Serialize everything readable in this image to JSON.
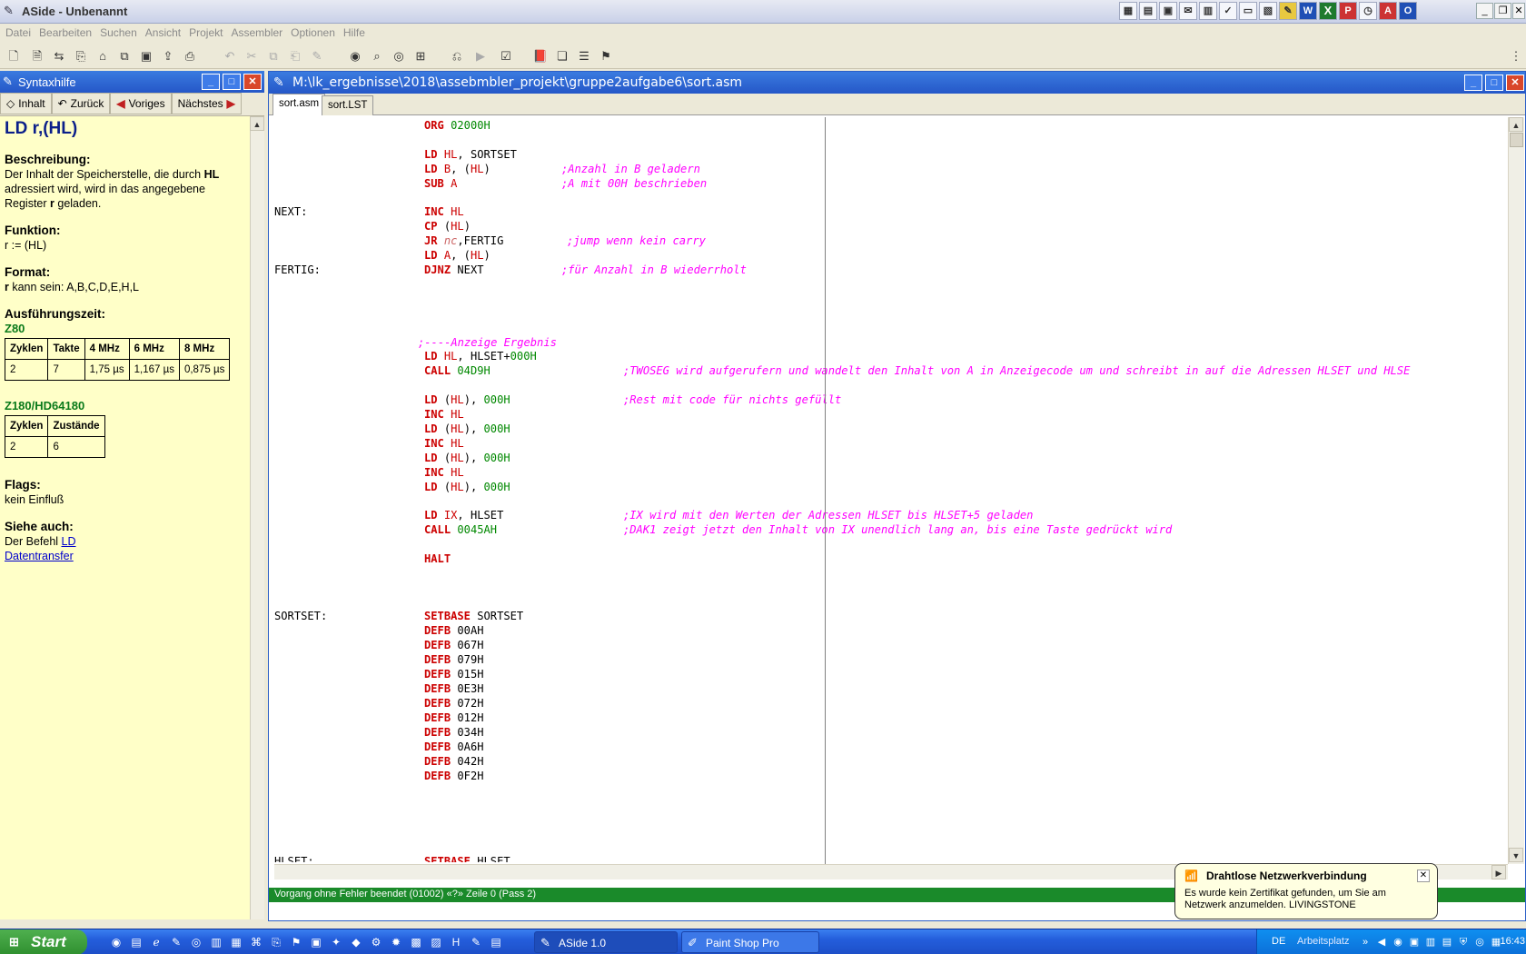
{
  "app": {
    "title": "ASide - Unbenannt"
  },
  "menubar": [
    "Datei",
    "Bearbeiten",
    "Suchen",
    "Ansicht",
    "Projekt",
    "Assembler",
    "Optionen",
    "Hilfe"
  ],
  "help": {
    "title": "Syntaxhilfe",
    "nav": {
      "inhalt": "Inhalt",
      "zurueck": "Zurück",
      "voriges": "Voriges",
      "naechstes": "Nächstes"
    },
    "heading": "LD r,(HL)",
    "beschreibung_title": "Beschreibung",
    "beschreibung_pre": "Der Inhalt der Speicherstelle, die durch ",
    "beschreibung_hl": "HL",
    "beschreibung_mid": " adressiert wird, wird in das angegebene Register ",
    "beschreibung_r": "r",
    "beschreibung_post": " geladen.",
    "funktion_title": "Funktion",
    "funktion": "r := (HL)",
    "format_title": "Format",
    "format_r": "r",
    "format": " kann sein: A,B,C,D,E,H,L",
    "zeit_title": "Ausführungszeit",
    "z80_label": "Z80",
    "z80_table": {
      "headers": [
        "Zyklen",
        "Takte",
        "4 MHz",
        "6 MHz",
        "8 MHz"
      ],
      "row": [
        "2",
        "7",
        "1,75 µs",
        "1,167 µs",
        "0,875 µs"
      ]
    },
    "z180_label": "Z180/HD64180",
    "z180_table": {
      "headers": [
        "Zyklen",
        "Zustände"
      ],
      "row": [
        "2",
        "6"
      ]
    },
    "flags_title": "Flags",
    "flags": "kein Einfluß",
    "siehe_title": "Siehe auch",
    "siehe_pre": "Der Befehl ",
    "siehe_link1": "LD",
    "siehe_link2": "Datentransfer"
  },
  "editor": {
    "title": "M:\\lk_ergebnisse\\2018\\assebmbler_projekt\\gruppe2aufgabe6\\sort.asm",
    "tabs": [
      "sort.asm",
      "sort.LST"
    ],
    "status": "Vorgang ohne Fehler beendet (01002) «?» Zeile 0 (Pass 2)",
    "code": {
      "l1_kw": "ORG",
      "l1_num": "02000H",
      "l2_kw": "LD",
      "l2_rg": "HL",
      "l2_rest": ", SORTSET",
      "l3_kw": "LD",
      "l3_rg": "B",
      "l3_mid": ", (",
      "l3_rg2": "HL",
      "l3_end": ")",
      "l3_cm": ";Anzahl in B geladern",
      "l4_kw": "SUB",
      "l4_rg": "A",
      "l4_cm": ";A mit 00H beschrieben",
      "l5_lbl": "NEXT:",
      "l5_kw": "INC",
      "l5_rg": "HL",
      "l6_kw": "CP",
      "l6_mid": "(",
      "l6_rg": "HL",
      "l6_end": ")",
      "l7_kw": "JR",
      "l7_cc": "nc",
      "l7_rest": ",FERTIG",
      "l7_cm": ";jump wenn kein carry",
      "l8_kw": "LD",
      "l8_rg": "A",
      "l8_mid": ", (",
      "l8_rg2": "HL",
      "l8_end": ")",
      "l9_lbl": "FERTIG:",
      "l9_kw": "DJNZ",
      "l9_rest": "NEXT",
      "l9_cm": ";für Anzahl in B wiederrholt",
      "l10_cm": ";----Anzeige Ergebnis",
      "l11_kw": "LD",
      "l11_rg": "HL",
      "l11_rest": ", HLSET+",
      "l11_num": "000H",
      "l12_kw": "CALL",
      "l12_num": "04D9H",
      "l12_cm": ";TWOSEG wird aufgerufern und wandelt den Inhalt von A in Anzeigecode um und schreibt in auf die Adressen HLSET und HLSE",
      "l13_kw": "LD",
      "l13_mid": "(",
      "l13_rg": "HL",
      "l13_end": "), ",
      "l13_num": "000H",
      "l13_cm": ";Rest mit code für nichts gefüllt",
      "l14_kw": "INC",
      "l14_rg": "HL",
      "l15_kw": "LD",
      "l15_mid": "(",
      "l15_rg": "HL",
      "l15_end": "), ",
      "l15_num": "000H",
      "l16_kw": "INC",
      "l16_rg": "HL",
      "l17_kw": "LD",
      "l17_mid": "(",
      "l17_rg": "HL",
      "l17_end": "), ",
      "l17_num": "000H",
      "l18_kw": "INC",
      "l18_rg": "HL",
      "l19_kw": "LD",
      "l19_mid": "(",
      "l19_rg": "HL",
      "l19_end": "), ",
      "l19_num": "000H",
      "l20_kw": "LD",
      "l20_rg": "IX",
      "l20_rest": ", HLSET",
      "l20_cm": ";IX wird mit den Werten der Adressen HLSET bis HLSET+5 geladen",
      "l21_kw": "CALL",
      "l21_num": "0045AH",
      "l21_cm": ";DAK1 zeigt jetzt den Inhalt von IX unendlich lang an, bis eine Taste gedrückt wird",
      "l22_kw": "HALT",
      "l23_lbl": "SORTSET:",
      "l23_kw": "SETBASE",
      "l23_rest": "SORTSET",
      "defb_kw": "DEFB",
      "defb_values": [
        "00AH",
        "067H",
        "079H",
        "015H",
        "0E3H",
        "072H",
        "012H",
        "034H",
        "0A6H",
        "042H",
        "0F2H"
      ],
      "l_last_lbl": "HLSET:",
      "l_last_kw": "SETBASE",
      "l_last_rest": "HLSET"
    }
  },
  "balloon": {
    "title": "Drahtlose Netzwerkverbindung",
    "message": "Es wurde kein Zertifikat gefunden, um Sie am Netzwerk anzumelden. LIVINGSTONE"
  },
  "taskbar": {
    "start": "Start",
    "tasks": [
      "ASide 1.0",
      "Paint Shop Pro"
    ],
    "lang": "DE",
    "arbeitsplatz": "Arbeitsplatz",
    "clock": "16:43"
  }
}
